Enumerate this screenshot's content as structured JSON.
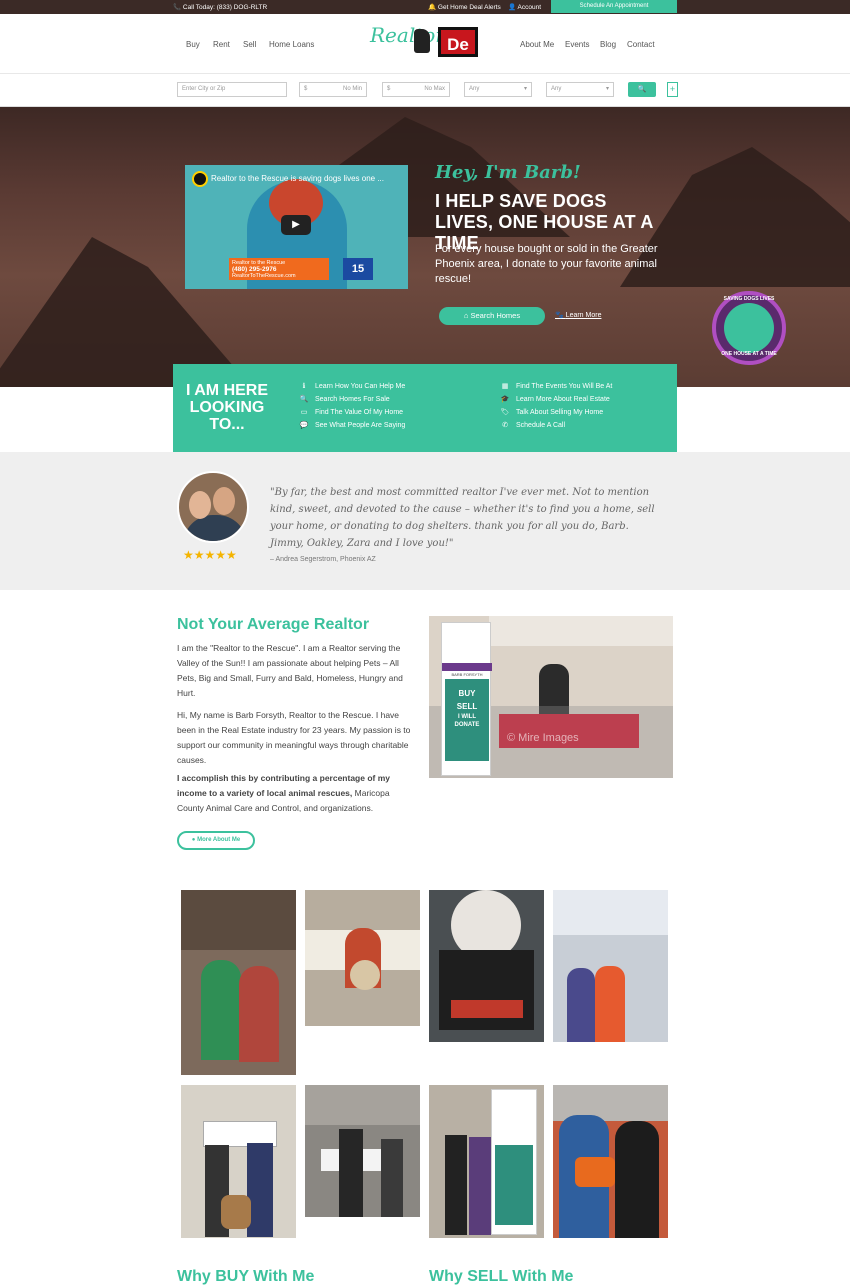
{
  "topbar": {
    "call": "📞 Call Today: (833) DOG-RLTR",
    "alerts": "🔔 Get Home Deal Alerts",
    "account": "👤 Account",
    "schedule": "Schedule An Appointment"
  },
  "nav_left": [
    "Buy",
    "Rent",
    "Sell",
    "Home Loans"
  ],
  "nav_right": [
    "About Me",
    "Events",
    "Blog",
    "Contact"
  ],
  "logo": {
    "word": "Realtor",
    "brand": "De"
  },
  "search": {
    "city_placeholder": "Enter City or Zip",
    "min_symbol": "$",
    "min_placeholder": "No Min",
    "max_symbol": "$",
    "max_placeholder": "No Max",
    "beds": "Any",
    "baths": "Any",
    "search_icon": "🔍",
    "plus": "+"
  },
  "hero": {
    "video_title": "Realtor to the Rescue is saving dogs lives one ...",
    "video_lower_1": "Realtor to the Rescue",
    "video_lower_2": "(480) 295-2976",
    "video_lower_3": "RealtorToTheRescue.com",
    "video_channel": "15",
    "greeting": "Hey, I'm Barb!",
    "headline": "I HELP SAVE DOGS LIVES, ONE HOUSE AT A TIME",
    "body": "For every house bought or sold in the Greater Phoenix area, I donate to your favorite animal rescue!",
    "cta": "Search Homes",
    "learn_more": "Learn More",
    "badge_top": "SAVING DOGS LIVES",
    "badge_bottom": "ONE HOUSE AT A TIME"
  },
  "looking": {
    "heading": "I AM HERE LOOKING TO...",
    "left": [
      {
        "icon": "ℹ",
        "label": "Learn How You Can Help Me"
      },
      {
        "icon": "🔍",
        "label": "Search Homes For Sale"
      },
      {
        "icon": "▭",
        "label": "Find The Value Of My Home"
      },
      {
        "icon": "💬",
        "label": "See What People Are Saying"
      }
    ],
    "right": [
      {
        "icon": "▦",
        "label": "Find The Events You Will Be At"
      },
      {
        "icon": "🎓",
        "label": "Learn More About Real Estate"
      },
      {
        "icon": "🏷",
        "label": "Talk About Selling My Home"
      },
      {
        "icon": "✆",
        "label": "Schedule A Call"
      }
    ]
  },
  "testimonial": {
    "stars": "★★★★★",
    "rating": 5,
    "quote": "\"By far, the best and most committed realtor I've ever met. Not to mention kind, sweet, and devoted to the cause – whether it's to find you a home, sell your home, or donating to dog shelters. thank you for all you do, Barb. Jimmy, Oakley, Zara and I love you!\"",
    "author": "– Andrea Segerstrom, Phoenix AZ"
  },
  "about": {
    "title": "Not Your Average Realtor",
    "p1": "I am the \"Realtor to the Rescue\". I am a Realtor serving the Valley of the Sun!! I am passionate about helping Pets – All Pets, Big and Small, Furry and Bald, Homeless, Hungry and Hurt.",
    "p2": "Hi, My name is Barb Forsyth,  Realtor to the Rescue. I have been in the Real Estate industry for 23 years. My passion is to support our community in meaningful ways through charitable causes.",
    "p3_bold": "I accomplish this by contributing a percentage of my income to a variety of  local  animal rescues,",
    "p3_rest": " Maricopa County Animal Care and Control, and organizations.",
    "button": "More About Me",
    "photo_sign_1": "BUY",
    "photo_sign_2": "SELL",
    "photo_sign_3": "I WILL DONATE",
    "photo_name": "BARB FORSYTH",
    "photo_watermark": "© Mire Images"
  },
  "sections": {
    "buy": "Why BUY With Me",
    "sell": "Why SELL With Me"
  },
  "colors": {
    "accent": "#3cc19d",
    "dark": "#3b2a26",
    "light_bg": "#efefef"
  }
}
